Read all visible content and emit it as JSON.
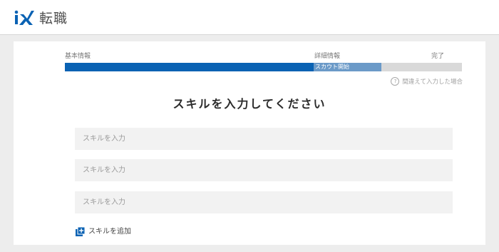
{
  "header": {
    "logo_mark": "iX",
    "logo_text": "転職",
    "brand_color": "#0a62b3"
  },
  "progress": {
    "steps": [
      {
        "label": "基本情報"
      },
      {
        "label": "詳細情報"
      },
      {
        "label": "完了"
      }
    ],
    "scout_label": "スカウト開始",
    "completed_fraction": 0.627,
    "scout_segment_end_fraction": 0.797,
    "colors": {
      "fill": "#0a62b3",
      "mid": "#6b9ac8",
      "track": "#d9d9d9"
    }
  },
  "help": {
    "icon": "question-circle-icon",
    "text": "間違えて入力した場合"
  },
  "form": {
    "title": "スキルを入力してください",
    "inputs": [
      {
        "placeholder": "スキルを入力",
        "value": ""
      },
      {
        "placeholder": "スキルを入力",
        "value": ""
      },
      {
        "placeholder": "スキルを入力",
        "value": ""
      }
    ],
    "add_button": {
      "icon": "add-box-icon",
      "label": "スキルを追加"
    }
  }
}
